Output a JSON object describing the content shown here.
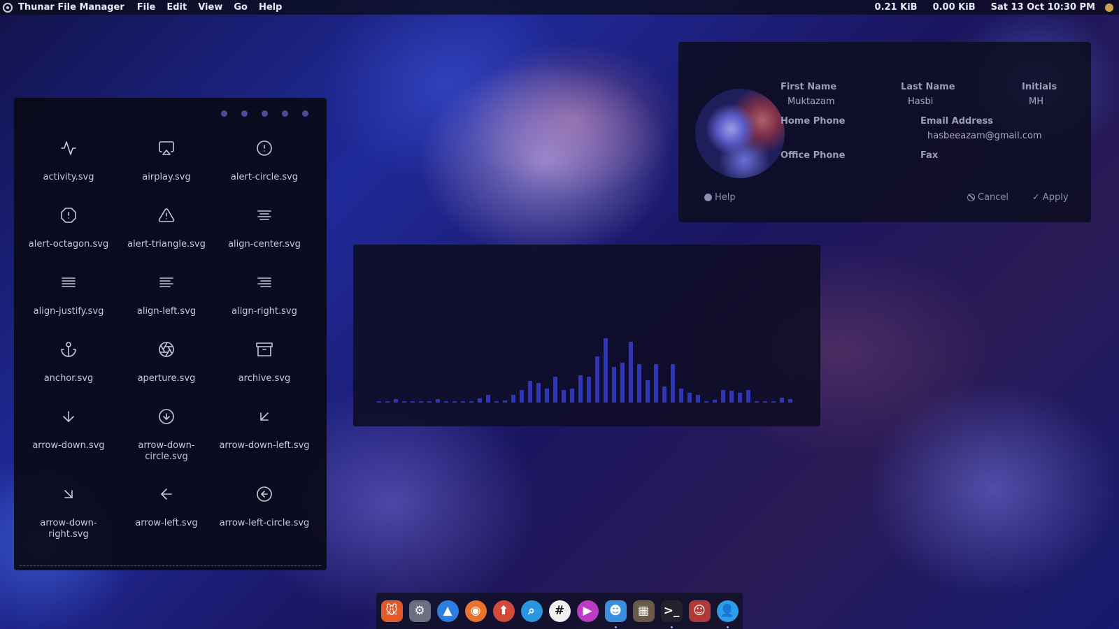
{
  "topbar": {
    "app_name": "Thunar File Manager",
    "menu": [
      "File",
      "Edit",
      "View",
      "Go",
      "Help"
    ],
    "net_down": "0.21 KiB",
    "net_up": "0.00 KiB",
    "datetime": "Sat 13 Oct  10:30 PM"
  },
  "icon_panel": {
    "pager_dots": 5,
    "icons": [
      {
        "name": "activity",
        "label": "activity.svg"
      },
      {
        "name": "airplay",
        "label": "airplay.svg"
      },
      {
        "name": "alert-circle",
        "label": "alert-circle.svg"
      },
      {
        "name": "alert-octagon",
        "label": "alert-octagon.svg"
      },
      {
        "name": "alert-triangle",
        "label": "alert-triangle.svg"
      },
      {
        "name": "align-center",
        "label": "align-center.svg"
      },
      {
        "name": "align-justify",
        "label": "align-justify.svg"
      },
      {
        "name": "align-left",
        "label": "align-left.svg"
      },
      {
        "name": "align-right",
        "label": "align-right.svg"
      },
      {
        "name": "anchor",
        "label": "anchor.svg"
      },
      {
        "name": "aperture",
        "label": "aperture.svg"
      },
      {
        "name": "archive",
        "label": "archive.svg"
      },
      {
        "name": "arrow-down",
        "label": "arrow-down.svg"
      },
      {
        "name": "arrow-down-circle",
        "label": "arrow-down-circle.svg"
      },
      {
        "name": "arrow-down-left",
        "label": "arrow-down-left.svg"
      },
      {
        "name": "arrow-down-right",
        "label": "arrow-down-right.svg"
      },
      {
        "name": "arrow-left",
        "label": "arrow-left.svg"
      },
      {
        "name": "arrow-left-circle",
        "label": "arrow-left-circle.svg"
      }
    ]
  },
  "contact": {
    "first_name_label": "First Name",
    "first_name": "Muktazam",
    "last_name_label": "Last Name",
    "last_name": "Hasbi",
    "initials_label": "Initials",
    "initials": "MH",
    "home_phone_label": "Home Phone",
    "email_label": "Email Address",
    "email": "hasbeeazam@gmail.com",
    "office_phone_label": "Office Phone",
    "fax_label": "Fax",
    "help_label": "Help",
    "cancel_label": "Cancel",
    "apply_label": "Apply"
  },
  "visualizer": {
    "levels": [
      0.01,
      0.01,
      0.05,
      0.01,
      0.01,
      0.01,
      0.01,
      0.05,
      0.01,
      0.01,
      0.01,
      0.01,
      0.06,
      0.12,
      0.02,
      0.03,
      0.12,
      0.2,
      0.34,
      0.3,
      0.22,
      0.4,
      0.2,
      0.22,
      0.42,
      0.4,
      0.72,
      1.0,
      0.55,
      0.62,
      0.95,
      0.6,
      0.35,
      0.6,
      0.25,
      0.6,
      0.22,
      0.15,
      0.12,
      0.01,
      0.04,
      0.2,
      0.18,
      0.15,
      0.2,
      0.02,
      0.01,
      0.01,
      0.08,
      0.05
    ],
    "bar_color": "#2f36b8"
  },
  "dock": {
    "apps": [
      {
        "name": "xfce-mouse-app",
        "glyph": "🐭",
        "color": "#e05a2a",
        "round": false,
        "running": false
      },
      {
        "name": "settings-app",
        "glyph": "⚙",
        "color": "#6a7080",
        "round": false,
        "running": false
      },
      {
        "name": "appcenter-app",
        "glyph": "▲",
        "color": "#2a7fe0",
        "round": true,
        "running": false
      },
      {
        "name": "firefox-app",
        "glyph": "◉",
        "color": "#e8732a",
        "round": true,
        "running": false
      },
      {
        "name": "upload-app",
        "glyph": "⬆",
        "color": "#d44a3a",
        "round": true,
        "running": false
      },
      {
        "name": "search-app",
        "glyph": "⌕",
        "color": "#2a96e0",
        "round": true,
        "running": false
      },
      {
        "name": "hashtag-app",
        "glyph": "#",
        "color": "#f0f0f0",
        "round": true,
        "running": false
      },
      {
        "name": "media-player-app",
        "glyph": "▶",
        "color": "#c03ac8",
        "round": true,
        "running": false
      },
      {
        "name": "file-manager-app",
        "glyph": "☻",
        "color": "#3a8ee0",
        "round": false,
        "running": true
      },
      {
        "name": "archive-app",
        "glyph": "▦",
        "color": "#6a5a48",
        "round": false,
        "running": false
      },
      {
        "name": "terminal-app",
        "glyph": ">_",
        "color": "#22232c",
        "round": false,
        "running": true
      },
      {
        "name": "avatar-app",
        "glyph": "☺",
        "color": "#b03a3a",
        "round": false,
        "running": false
      },
      {
        "name": "user-app",
        "glyph": "👤",
        "color": "#2a9ee8",
        "round": true,
        "running": true
      }
    ]
  }
}
